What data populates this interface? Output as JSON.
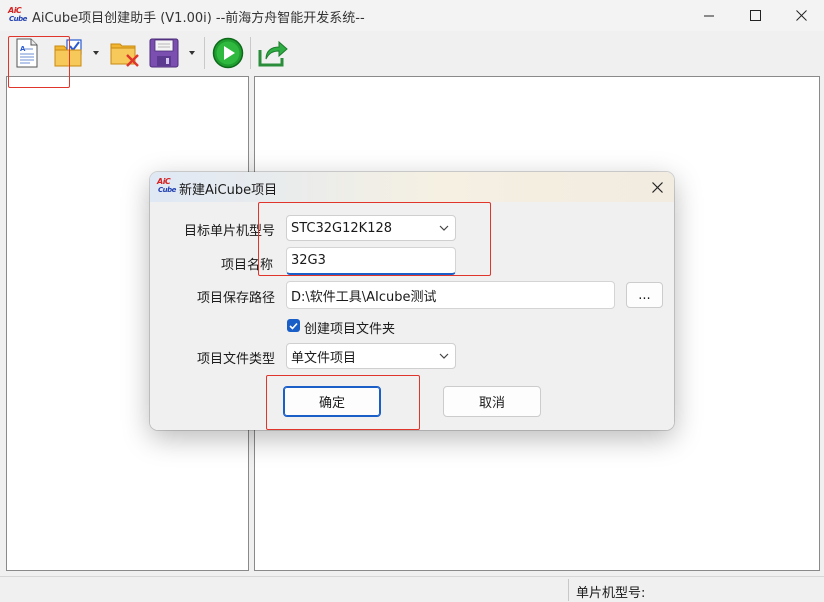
{
  "window": {
    "title": "AiCube项目创建助手 (V1.00i) --前海方舟智能开发系统--",
    "logo_line1": "AiC",
    "logo_line2": "Cube",
    "minimize_icon": "minimize-icon",
    "maximize_icon": "maximize-icon",
    "close_icon": "close-icon"
  },
  "toolbar": {
    "items": [
      {
        "icon": "new-document-icon"
      },
      {
        "icon": "open-folder-checklist-icon"
      },
      {
        "icon": "delete-folder-icon"
      },
      {
        "icon": "save-floppy-icon"
      },
      {
        "icon": "run-play-icon"
      },
      {
        "icon": "export-share-icon"
      }
    ]
  },
  "statusbar": {
    "mcu_label": "单片机型号:"
  },
  "dialog": {
    "title": "新建AiCube项目",
    "logo_line1": "AiC",
    "logo_line2": "Cube",
    "target_mcu_label": "目标单片机型号",
    "target_mcu_value": "STC32G12K128",
    "project_name_label": "项目名称",
    "project_name_value": "32G3",
    "save_path_label": "项目保存路径",
    "save_path_value": "D:\\软件工具\\AIcube测试",
    "browse_label": "...",
    "create_folder_label": "创建项目文件夹",
    "create_folder_checked": true,
    "file_type_label": "项目文件类型",
    "file_type_value": "单文件项目",
    "ok_label": "确定",
    "cancel_label": "取消"
  },
  "colors": {
    "accent": "#1a5fc7",
    "annotation_red": "#e0352b",
    "play_green": "#1f9d2f"
  }
}
